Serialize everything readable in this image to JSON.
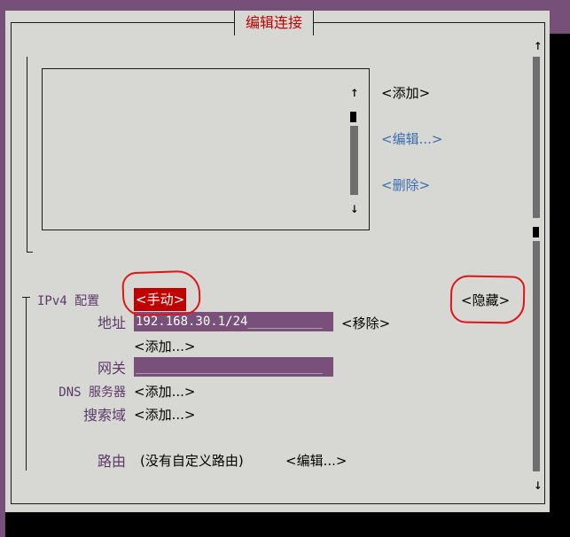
{
  "dialog": {
    "title": "编辑连接"
  },
  "list_buttons": {
    "add": "<添加>",
    "edit": "<编辑...>",
    "delete": "<删除>"
  },
  "scroll": {
    "up": "↑",
    "down": "↓"
  },
  "ipv4": {
    "label": "IPv4 配置",
    "method": "<手动>",
    "hide": "<隐藏>",
    "address_label": "地址",
    "address_value": "192.168.30.1/24",
    "address_fill": "__________",
    "remove": "<移除>",
    "add_address": "<添加...>",
    "gateway_label": "网关",
    "gateway_value": "",
    "gateway_fill": "_________________________",
    "dns_label": "DNS 服务器",
    "dns_add": "<添加...>",
    "search_label": "搜索域",
    "search_add": "<添加...>",
    "route_label": "路由",
    "route_value": "(没有自定义路由)",
    "route_edit": "<编辑...>"
  },
  "colors": {
    "dialog_bg": "#d7d7d3",
    "terminal_purple": "#77507a",
    "field_bg": "#78507a",
    "accent_red": "#c00000",
    "link_blue": "#3b6fb0",
    "annotation_red": "#e0151a"
  }
}
